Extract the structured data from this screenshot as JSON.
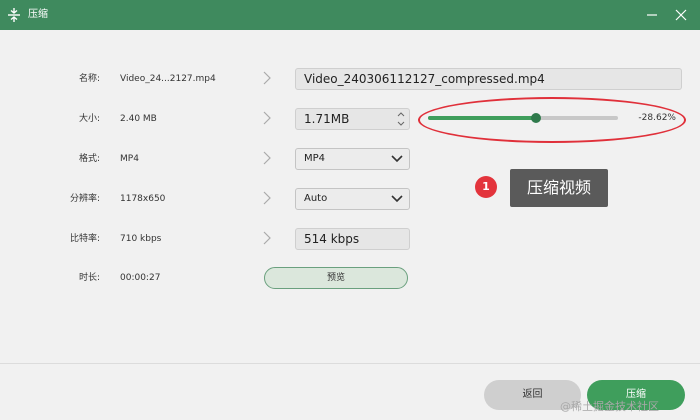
{
  "window": {
    "title": "压缩",
    "app_icon": "compress-icon",
    "controls": [
      "minimize-icon",
      "close-icon"
    ]
  },
  "rows": {
    "name": {
      "label": "名称:",
      "original": "Video_24...2127.mp4",
      "output": "Video_240306112127_compressed.mp4"
    },
    "size": {
      "label": "大小:",
      "original": "2.40 MB",
      "output": "1.71MB"
    },
    "format": {
      "label": "格式:",
      "original": "MP4",
      "output": "MP4"
    },
    "resolution": {
      "label": "分辨率:",
      "original": "1178x650",
      "output": "Auto"
    },
    "bitrate": {
      "label": "比特率:",
      "original": "710 kbps",
      "output": "514 kbps"
    },
    "duration": {
      "label": "时长:",
      "original": "00:00:27"
    }
  },
  "slider": {
    "value_label": "-28.62%",
    "fill_fraction": 0.57
  },
  "annotation": {
    "badge": "1",
    "text": "压缩视频",
    "color": "#e3343c"
  },
  "buttons": {
    "preview": "预览",
    "back": "返回",
    "compress": "压缩"
  },
  "watermark": "@稀土掘金技术社区",
  "colors": {
    "accent": "#3f8a5e",
    "accent_button": "#3f9e5c",
    "highlight": "#e0303a"
  }
}
